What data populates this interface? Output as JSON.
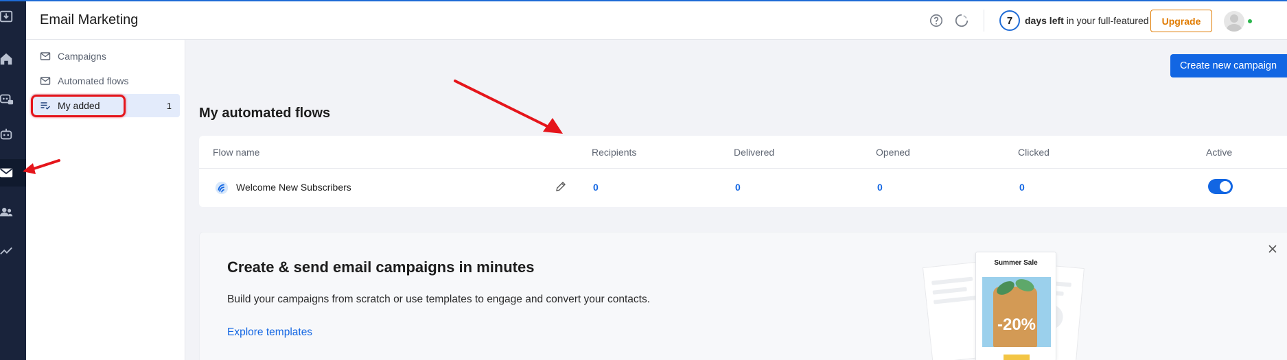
{
  "app": {
    "title": "Email Marketing"
  },
  "header": {
    "trial_days": "7",
    "trial_bold": "days left",
    "trial_rest": " in your full-featured trial",
    "upgrade_label": "Upgrade"
  },
  "rail": {
    "items": [
      {
        "icon": "inbox-download-icon"
      },
      {
        "icon": "home-icon"
      },
      {
        "icon": "ai-bot-icon"
      },
      {
        "icon": "bot-icon"
      },
      {
        "icon": "email-icon",
        "active": true
      },
      {
        "icon": "contacts-icon"
      },
      {
        "icon": "analytics-icon"
      }
    ]
  },
  "subnav": {
    "items": [
      {
        "label": "Campaigns",
        "icon": "envelope-icon"
      },
      {
        "label": "Automated flows",
        "icon": "envelope-icon"
      },
      {
        "label": "My added",
        "icon": "list-check-icon",
        "count": "1",
        "active": true
      }
    ]
  },
  "main": {
    "create_button": "Create new campaign",
    "section_title": "My automated flows",
    "table": {
      "columns": [
        "Flow name",
        "Recipients",
        "Delivered",
        "Opened",
        "Clicked",
        "Active"
      ],
      "rows": [
        {
          "name": "Welcome New Subscribers",
          "recipients": "0",
          "delivered": "0",
          "opened": "0",
          "clicked": "0",
          "active": true
        }
      ]
    },
    "promo": {
      "title": "Create & send email campaigns in minutes",
      "description": "Build your campaigns from scratch or use templates to engage and convert your contacts.",
      "link": "Explore templates",
      "art_title": "Summer Sale",
      "art_discount": "-20%"
    }
  },
  "colors": {
    "accent": "#1266e3",
    "rail": "#19233b",
    "upgrade": "#e07b00",
    "annotation": "#e5151b"
  }
}
